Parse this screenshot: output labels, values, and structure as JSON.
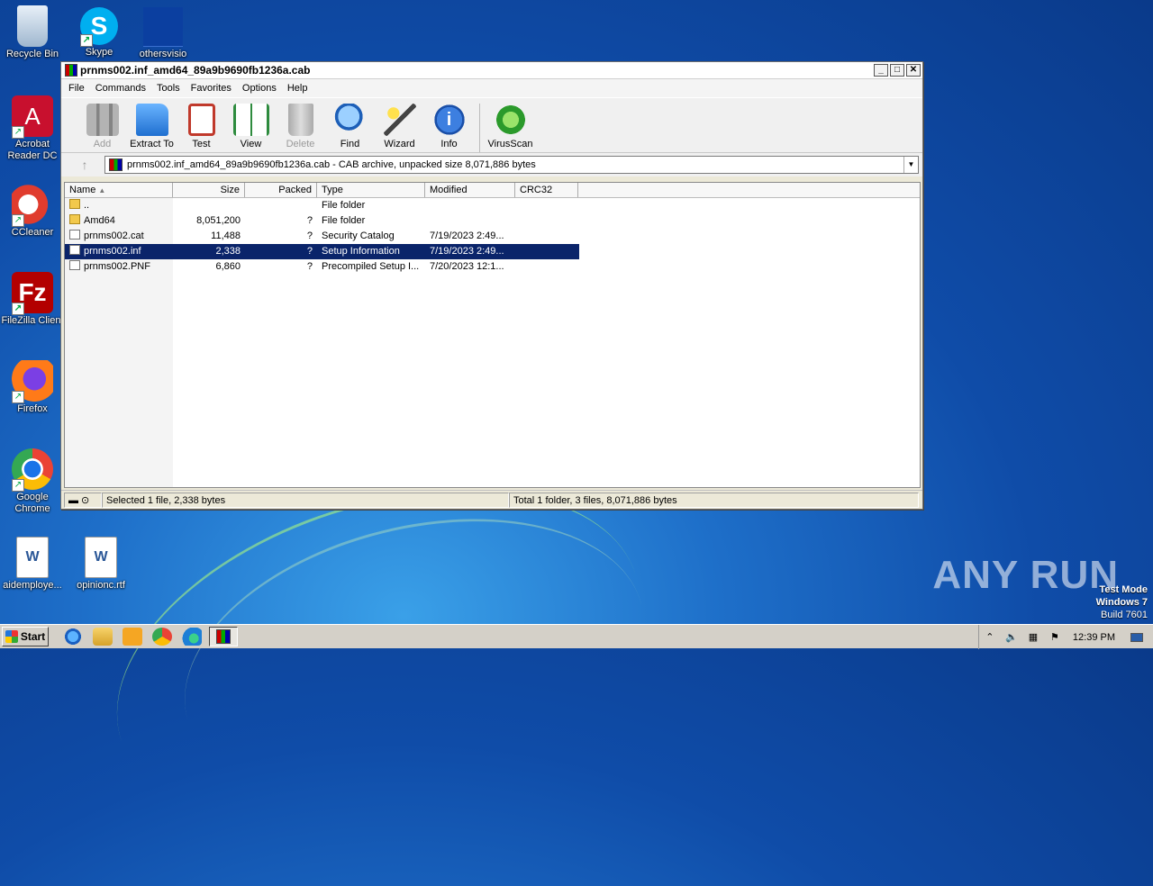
{
  "desktop": {
    "icons": [
      {
        "label": "Recycle Bin",
        "icon": "recycle-bin-icon"
      },
      {
        "label": "Skype",
        "icon": "skype-icon"
      },
      {
        "label": "othersvisio",
        "icon": "folder-icon"
      },
      {
        "label": "Acrobat Reader DC",
        "icon": "acrobat-icon"
      },
      {
        "label": "CCleaner",
        "icon": "ccleaner-icon"
      },
      {
        "label": "FileZilla Client",
        "icon": "filezilla-icon"
      },
      {
        "label": "Firefox",
        "icon": "firefox-icon"
      },
      {
        "label": "Google Chrome",
        "icon": "chrome-icon"
      },
      {
        "label": "aidemploye...",
        "icon": "word-doc-icon"
      },
      {
        "label": "opinionc.rtf",
        "icon": "word-doc-icon"
      }
    ],
    "watermark": "ANY RUN",
    "test_mode": {
      "line1": "Test Mode",
      "line2": "Windows 7",
      "line3": "Build 7601"
    }
  },
  "window": {
    "title": "prnms002.inf_amd64_89a9b9690fb1236a.cab",
    "menu": [
      "File",
      "Commands",
      "Tools",
      "Favorites",
      "Options",
      "Help"
    ],
    "toolbar": [
      {
        "label": "Add",
        "icon": "add-archive-icon",
        "enabled": false
      },
      {
        "label": "Extract To",
        "icon": "extract-folder-icon",
        "enabled": true
      },
      {
        "label": "Test",
        "icon": "test-clipboard-icon",
        "enabled": true
      },
      {
        "label": "View",
        "icon": "view-book-icon",
        "enabled": true
      },
      {
        "label": "Delete",
        "icon": "trash-icon",
        "enabled": false
      },
      {
        "label": "Find",
        "icon": "magnifier-icon",
        "enabled": true
      },
      {
        "label": "Wizard",
        "icon": "wand-icon",
        "enabled": true
      },
      {
        "label": "Info",
        "icon": "info-icon",
        "enabled": true
      },
      {
        "label": "VirusScan",
        "icon": "virus-scan-icon",
        "enabled": true
      }
    ],
    "address": "prnms002.inf_amd64_89a9b9690fb1236a.cab - CAB archive, unpacked size 8,071,886 bytes",
    "columns": [
      "Name",
      "Size",
      "Packed",
      "Type",
      "Modified",
      "CRC32"
    ],
    "rows": [
      {
        "name": "..",
        "size": "",
        "packed": "",
        "type": "File folder",
        "modified": "",
        "icon": "folder"
      },
      {
        "name": "Amd64",
        "size": "8,051,200",
        "packed": "?",
        "type": "File folder",
        "modified": "",
        "icon": "folder"
      },
      {
        "name": "prnms002.cat",
        "size": "11,488",
        "packed": "?",
        "type": "Security Catalog",
        "modified": "7/19/2023 2:49...",
        "icon": "doc"
      },
      {
        "name": "prnms002.inf",
        "size": "2,338",
        "packed": "?",
        "type": "Setup Information",
        "modified": "7/19/2023 2:49...",
        "icon": "doc",
        "selected": true
      },
      {
        "name": "prnms002.PNF",
        "size": "6,860",
        "packed": "?",
        "type": "Precompiled Setup I...",
        "modified": "7/20/2023 12:1...",
        "icon": "doc"
      }
    ],
    "status_left": "Selected 1 file, 2,338 bytes",
    "status_right": "Total 1 folder, 3 files, 8,071,886 bytes"
  },
  "taskbar": {
    "start_label": "Start",
    "clock": "12:39 PM"
  }
}
